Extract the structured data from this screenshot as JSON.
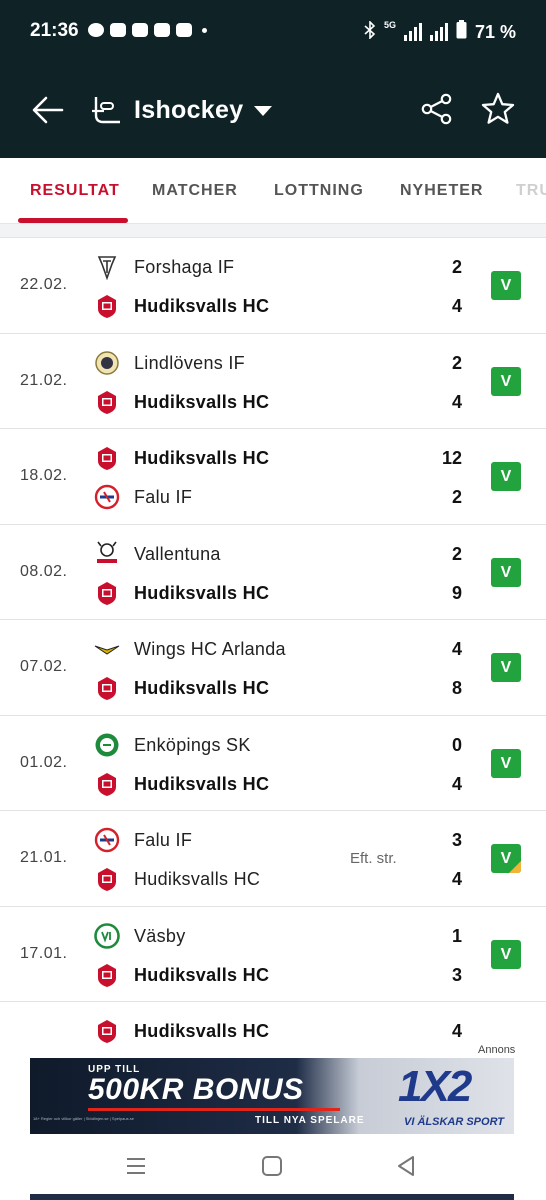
{
  "status_bar": {
    "time": "21:36",
    "network": "5G",
    "battery": "71 %"
  },
  "app_bar": {
    "title": "Ishockey",
    "icons": [
      "back-arrow-icon",
      "hockey-icon",
      "dropdown-caret-icon",
      "share-icon",
      "star-icon"
    ]
  },
  "tabs": [
    {
      "label": "RESULTAT",
      "active": true
    },
    {
      "label": "MATCHER",
      "active": false
    },
    {
      "label": "LOTTNING",
      "active": false
    },
    {
      "label": "NYHETER",
      "active": false
    },
    {
      "label": "TRU",
      "active": false
    }
  ],
  "results": [
    {
      "date": "22.02.",
      "home": "Forshaga IF",
      "home_score": "2",
      "home_bold": false,
      "away": "Hudiksvalls HC",
      "away_score": "4",
      "away_bold": true,
      "note": "",
      "badge": "V"
    },
    {
      "date": "21.02.",
      "home": "Lindlövens IF",
      "home_score": "2",
      "home_bold": false,
      "away": "Hudiksvalls HC",
      "away_score": "4",
      "away_bold": true,
      "note": "",
      "badge": "V"
    },
    {
      "date": "18.02.",
      "home": "Hudiksvalls HC",
      "home_score": "12",
      "home_bold": true,
      "away": "Falu IF",
      "away_score": "2",
      "away_bold": false,
      "note": "",
      "badge": "V"
    },
    {
      "date": "08.02.",
      "home": "Vallentuna",
      "home_score": "2",
      "home_bold": false,
      "away": "Hudiksvalls HC",
      "away_score": "9",
      "away_bold": true,
      "note": "",
      "badge": "V"
    },
    {
      "date": "07.02.",
      "home": "Wings HC Arlanda",
      "home_score": "4",
      "home_bold": false,
      "away": "Hudiksvalls HC",
      "away_score": "8",
      "away_bold": true,
      "note": "",
      "badge": "V"
    },
    {
      "date": "01.02.",
      "home": "Enköpings SK",
      "home_score": "0",
      "home_bold": false,
      "away": "Hudiksvalls HC",
      "away_score": "4",
      "away_bold": true,
      "note": "",
      "badge": "V"
    },
    {
      "date": "21.01.",
      "home": "Falu IF",
      "home_score": "3",
      "home_bold": false,
      "away": "Hudiksvalls HC",
      "away_score": "4",
      "away_bold": false,
      "note": "Eft. str.",
      "badge": "V"
    },
    {
      "date": "17.01.",
      "home": "Väsby",
      "home_score": "1",
      "home_bold": false,
      "away": "Hudiksvalls HC",
      "away_score": "3",
      "away_bold": true,
      "note": "",
      "badge": "V"
    },
    {
      "date": "",
      "home": "Hudiksvalls HC",
      "home_score": "4",
      "home_bold": true,
      "away": "",
      "away_score": "",
      "away_bold": false,
      "note": "",
      "badge": ""
    }
  ],
  "ad": {
    "label": "Annons",
    "upto": "UPP TILL",
    "headline": "500KR BONUS",
    "sub": "TILL NYA SPELARE",
    "brand": "1X2",
    "slogan": "VI ÄLSKAR SPORT",
    "fine_print": "18+ Regler och villkor gäller | Stödlinjen.se | Spelpaus.se"
  },
  "colors": {
    "header_bg": "#0f2327",
    "accent": "#c8102e",
    "win_badge": "#23a33d",
    "ot_corner": "#f0b43a"
  }
}
